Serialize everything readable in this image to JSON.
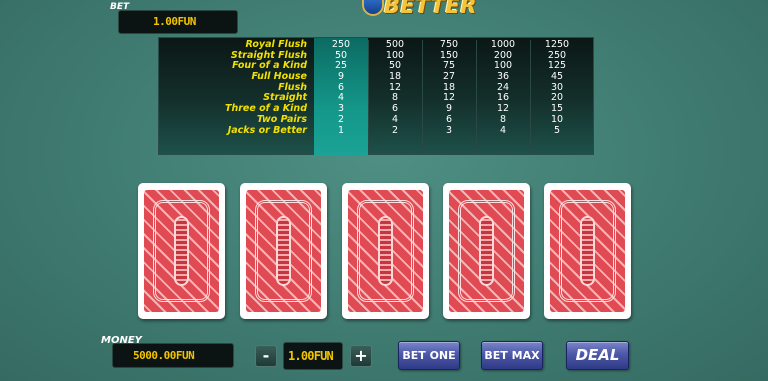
{
  "logo": {
    "text": "BETTER"
  },
  "bet": {
    "label": "BET",
    "value": "1.00FUN"
  },
  "paytable": {
    "hands": [
      "Royal Flush",
      "Straight Flush",
      "Four of a Kind",
      "Full House",
      "Flush",
      "Straight",
      "Three of a Kind",
      "Two Pairs",
      "Jacks or Better"
    ],
    "columns": [
      [
        "250",
        "50",
        "25",
        "9",
        "6",
        "4",
        "3",
        "2",
        "1"
      ],
      [
        "500",
        "100",
        "50",
        "18",
        "12",
        "8",
        "6",
        "4",
        "2"
      ],
      [
        "750",
        "150",
        "75",
        "27",
        "18",
        "12",
        "9",
        "6",
        "3"
      ],
      [
        "1000",
        "200",
        "100",
        "36",
        "24",
        "16",
        "12",
        "8",
        "4"
      ],
      [
        "1250",
        "250",
        "125",
        "45",
        "30",
        "20",
        "15",
        "10",
        "5"
      ]
    ],
    "highlighted_column": 1
  },
  "cards": [
    "card-back",
    "card-back",
    "card-back",
    "card-back",
    "card-back"
  ],
  "money": {
    "label": "MONEY",
    "value": "5000.00FUN"
  },
  "denomination": {
    "value": "1.00FUN",
    "minus": "-",
    "plus": "+"
  },
  "buttons": {
    "bet_one": "BET ONE",
    "bet_max": "BET MAX",
    "deal": "DEAL"
  },
  "colors": {
    "felt": "#3f7b71",
    "accent_yellow": "#f2e100",
    "button_blue": "#4c58a8",
    "card_red": "#e04a52"
  }
}
